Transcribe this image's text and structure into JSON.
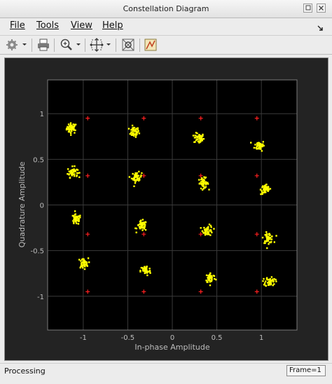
{
  "window": {
    "title": "Constellation Diagram"
  },
  "menu": {
    "file": "File",
    "tools": "Tools",
    "view": "View",
    "help": "Help"
  },
  "toolbar": {
    "icons": [
      "gear-icon",
      "print-icon",
      "zoom-in-icon",
      "fit-icon",
      "constellation-icon",
      "edit-plot-icon"
    ]
  },
  "status": {
    "left": "Processing",
    "frame": "Frame=1"
  },
  "colors": {
    "points": "#ffff00",
    "reference": "#ff2020",
    "background": "#000000",
    "grid": "#3a3a3a"
  },
  "chart_data": {
    "type": "scatter",
    "title": "",
    "xlabel": "In-phase Amplitude",
    "ylabel": "Quadrature Amplitude",
    "xlim": [
      -1.4,
      1.4
    ],
    "ylim": [
      -1.37,
      1.37
    ],
    "xticks": [
      -1,
      -0.5,
      0,
      0.5,
      1
    ],
    "yticks": [
      1,
      0.5,
      0,
      -0.5,
      -1
    ],
    "grid": true,
    "reference_points": [
      [
        -0.95,
        0.95
      ],
      [
        -0.32,
        0.95
      ],
      [
        0.32,
        0.95
      ],
      [
        0.95,
        0.95
      ],
      [
        -0.95,
        0.32
      ],
      [
        -0.32,
        0.32
      ],
      [
        0.32,
        0.32
      ],
      [
        0.95,
        0.32
      ],
      [
        -0.95,
        -0.32
      ],
      [
        -0.32,
        -0.32
      ],
      [
        0.32,
        -0.32
      ],
      [
        0.95,
        -0.32
      ],
      [
        -0.95,
        -0.95
      ],
      [
        -0.32,
        -0.95
      ],
      [
        0.32,
        -0.95
      ],
      [
        0.95,
        -0.95
      ]
    ],
    "received_clusters": [
      [
        -1.13,
        0.84
      ],
      [
        -0.43,
        0.8
      ],
      [
        0.3,
        0.73
      ],
      [
        0.98,
        0.65
      ],
      [
        -1.12,
        0.36
      ],
      [
        -0.4,
        0.3
      ],
      [
        0.35,
        0.24
      ],
      [
        1.05,
        0.17
      ],
      [
        -1.08,
        -0.16
      ],
      [
        -0.34,
        -0.23
      ],
      [
        0.4,
        -0.28
      ],
      [
        1.08,
        -0.36
      ],
      [
        -1.0,
        -0.64
      ],
      [
        -0.3,
        -0.72
      ],
      [
        0.43,
        -0.8
      ],
      [
        1.1,
        -0.84
      ]
    ]
  }
}
